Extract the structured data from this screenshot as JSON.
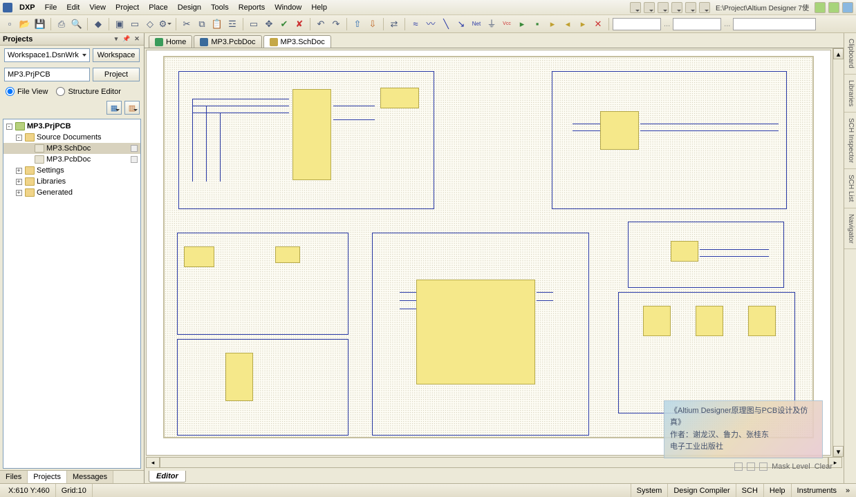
{
  "menu": {
    "logo": "DXP",
    "items": [
      "File",
      "Edit",
      "View",
      "Project",
      "Place",
      "Design",
      "Tools",
      "Reports",
      "Window",
      "Help"
    ],
    "path": "E:\\Project\\Altium Designer 7使"
  },
  "panel": {
    "title": "Projects",
    "workspace_combo": "Workspace1.DsnWrk",
    "workspace_btn": "Workspace",
    "project_txt": "MP3.PrjPCB",
    "project_btn": "Project",
    "radio_file": "File View",
    "radio_struct": "Structure Editor",
    "tree": [
      {
        "d": 0,
        "tw": "-",
        "ico": "prj",
        "lbl": "MP3.PrjPCB",
        "bold": true
      },
      {
        "d": 1,
        "tw": "-",
        "ico": "fld",
        "lbl": "Source Documents"
      },
      {
        "d": 2,
        "tw": "",
        "ico": "doc",
        "lbl": "MP3.SchDoc",
        "sel": true,
        "flag": true
      },
      {
        "d": 2,
        "tw": "",
        "ico": "doc",
        "lbl": "MP3.PcbDoc",
        "flag": true
      },
      {
        "d": 1,
        "tw": "+",
        "ico": "fld",
        "lbl": "Settings"
      },
      {
        "d": 1,
        "tw": "+",
        "ico": "fld",
        "lbl": "Libraries"
      },
      {
        "d": 1,
        "tw": "+",
        "ico": "fld",
        "lbl": "Generated"
      }
    ],
    "tabs": [
      "Files",
      "Projects",
      "Messages"
    ],
    "active_tab": 1
  },
  "doc_tabs": [
    {
      "lbl": "Home",
      "ico": "home"
    },
    {
      "lbl": "MP3.PcbDoc",
      "ico": "pcb"
    },
    {
      "lbl": "MP3.SchDoc",
      "ico": "sch",
      "active": true
    }
  ],
  "editor_tab": "Editor",
  "watermark": {
    "l1": "《Altium Designer原理图与PCB设计及仿真》",
    "l2": "作者：谢龙汉、鲁力、张桂东",
    "l3": "电子工业出版社"
  },
  "mask": {
    "label": "Mask Level",
    "clear": "Clear"
  },
  "right_dock": [
    "Clipboard",
    "Libraries",
    "SCH Inspector",
    "SCH List",
    "Navigator"
  ],
  "status": {
    "coord": "X:610 Y:460",
    "grid": "Grid:10",
    "tabs": [
      "System",
      "Design Compiler",
      "SCH",
      "Help",
      "Instruments"
    ],
    "more": "»"
  }
}
